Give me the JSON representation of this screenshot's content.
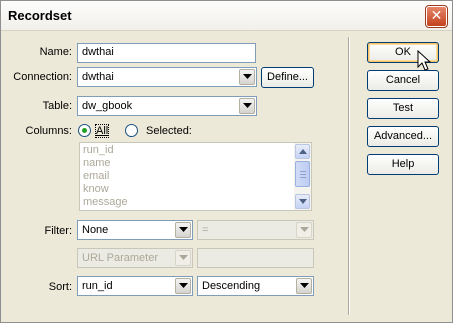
{
  "dialog": {
    "title": "Recordset",
    "close_glyph": "✕"
  },
  "form": {
    "name_label": "Name:",
    "name_value": "dwthai",
    "connection_label": "Connection:",
    "connection_value": "dwthai",
    "define_button": "Define...",
    "table_label": "Table:",
    "table_value": "dw_gbook",
    "columns_label": "Columns:",
    "columns_all": "All",
    "columns_selected": "Selected:",
    "columns_all_checked": true,
    "columns_list": [
      "run_id",
      "name",
      "email",
      "know",
      "message"
    ],
    "filter_label": "Filter:",
    "filter_value": "None",
    "filter_operator": "=",
    "filter_source": "URL Parameter",
    "filter_param": "",
    "sort_label": "Sort:",
    "sort_column": "run_id",
    "sort_order": "Descending"
  },
  "buttons": {
    "ok": "OK",
    "cancel": "Cancel",
    "test": "Test",
    "advanced": "Advanced...",
    "help": "Help"
  },
  "icons": {
    "close": "close-icon",
    "dropdown": "chevron-down-icon",
    "scroll_up": "scroll-up-icon",
    "scroll_down": "scroll-down-icon",
    "cursor": "mouse-pointer-icon"
  },
  "colors": {
    "dialog_bg": "#ece9d8",
    "close_button": "#c4421e",
    "radio_selected": "#21a121",
    "field_border": "#7f9db9",
    "disabled_text": "#aca899"
  }
}
